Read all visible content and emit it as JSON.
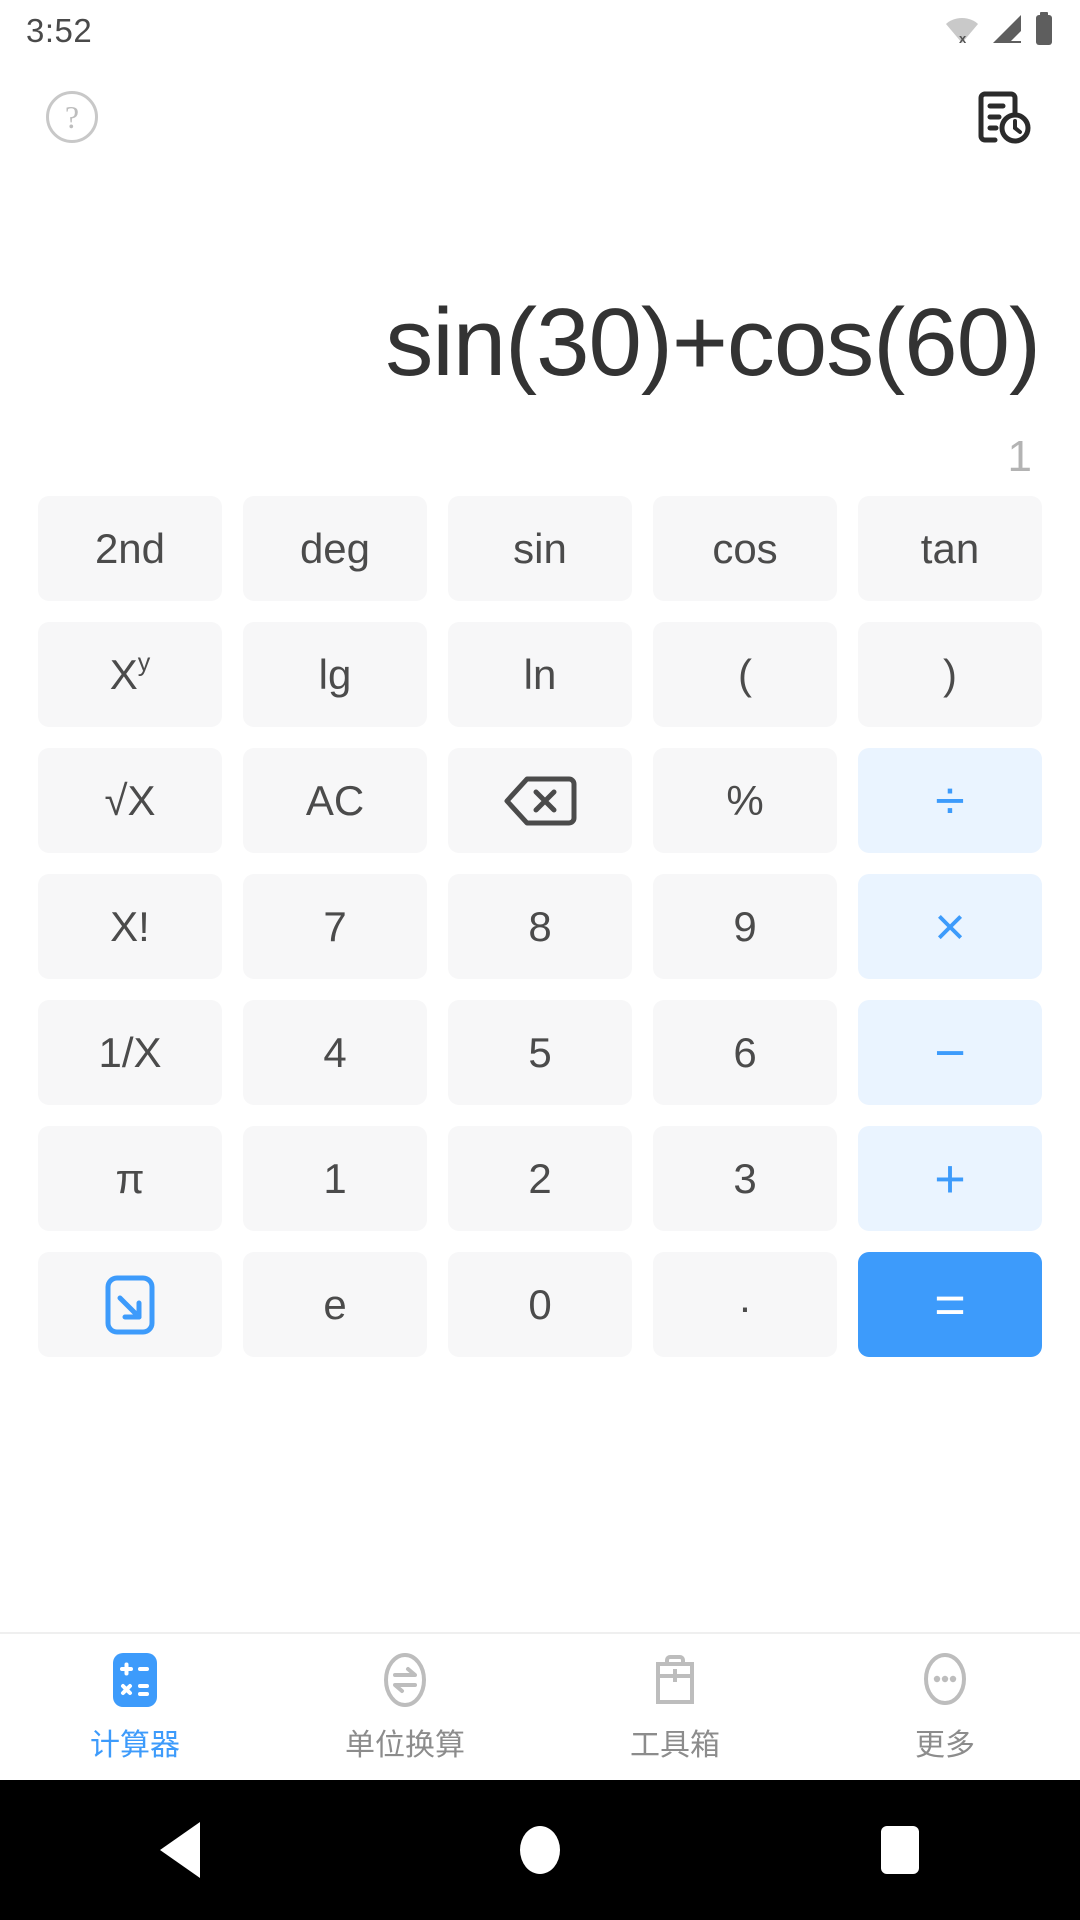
{
  "status_bar": {
    "time": "3:52",
    "icons": [
      "wifi-off-icon",
      "cellular-signal-icon",
      "battery-full-icon"
    ]
  },
  "top_bar": {
    "help_label": "?",
    "help_icon": "help-circle-icon",
    "history_icon": "history-document-icon"
  },
  "display": {
    "expression": "sin(30)+cos(60)",
    "result": "1"
  },
  "colors": {
    "accent": "#3d9bfb",
    "operator_bg": "#eaf4ff",
    "key_bg": "#f7f7f8",
    "expression_text": "#333333",
    "result_text": "#b3b3b3"
  },
  "keypad": {
    "rows": [
      [
        {
          "label": "2nd",
          "name": "key-2nd",
          "type": "fn"
        },
        {
          "label": "deg",
          "name": "key-deg",
          "type": "fn"
        },
        {
          "label": "sin",
          "name": "key-sin",
          "type": "fn"
        },
        {
          "label": "cos",
          "name": "key-cos",
          "type": "fn"
        },
        {
          "label": "tan",
          "name": "key-tan",
          "type": "fn"
        }
      ],
      [
        {
          "label": "X",
          "sup": "y",
          "name": "key-power",
          "type": "fn"
        },
        {
          "label": "lg",
          "name": "key-lg",
          "type": "fn"
        },
        {
          "label": "ln",
          "name": "key-ln",
          "type": "fn"
        },
        {
          "label": "(",
          "name": "key-open-paren",
          "type": "fn"
        },
        {
          "label": ")",
          "name": "key-close-paren",
          "type": "fn"
        }
      ],
      [
        {
          "label": "√X",
          "name": "key-square-root",
          "type": "fn"
        },
        {
          "label": "AC",
          "name": "key-all-clear",
          "type": "fn"
        },
        {
          "label": "",
          "icon": "backspace-icon",
          "name": "key-backspace",
          "type": "fn"
        },
        {
          "label": "%",
          "name": "key-percent",
          "type": "fn"
        },
        {
          "label": "÷",
          "name": "key-divide",
          "type": "op"
        }
      ],
      [
        {
          "label": "X!",
          "name": "key-factorial",
          "type": "fn"
        },
        {
          "label": "7",
          "name": "key-7",
          "type": "num"
        },
        {
          "label": "8",
          "name": "key-8",
          "type": "num"
        },
        {
          "label": "9",
          "name": "key-9",
          "type": "num"
        },
        {
          "label": "×",
          "name": "key-multiply",
          "type": "op"
        }
      ],
      [
        {
          "label": "1/X",
          "name": "key-reciprocal",
          "type": "fn"
        },
        {
          "label": "4",
          "name": "key-4",
          "type": "num"
        },
        {
          "label": "5",
          "name": "key-5",
          "type": "num"
        },
        {
          "label": "6",
          "name": "key-6",
          "type": "num"
        },
        {
          "label": "−",
          "name": "key-subtract",
          "type": "op"
        }
      ],
      [
        {
          "label": "π",
          "name": "key-pi",
          "type": "fn"
        },
        {
          "label": "1",
          "name": "key-1",
          "type": "num"
        },
        {
          "label": "2",
          "name": "key-2",
          "type": "num"
        },
        {
          "label": "3",
          "name": "key-3",
          "type": "num"
        },
        {
          "label": "+",
          "name": "key-add",
          "type": "op"
        }
      ],
      [
        {
          "label": "",
          "icon": "collapse-keypad-icon",
          "name": "key-collapse-keypad",
          "type": "fn"
        },
        {
          "label": "e",
          "name": "key-e",
          "type": "num"
        },
        {
          "label": "0",
          "name": "key-0",
          "type": "num"
        },
        {
          "label": ".",
          "name": "key-decimal-point",
          "type": "num"
        },
        {
          "label": "=",
          "name": "key-equals",
          "type": "equals"
        }
      ]
    ]
  },
  "tab_bar": {
    "items": [
      {
        "label": "计算器",
        "icon": "calculator-icon",
        "name": "tab-calculator",
        "active": true
      },
      {
        "label": "单位换算",
        "icon": "unit-convert-icon",
        "name": "tab-unit-conversion",
        "active": false
      },
      {
        "label": "工具箱",
        "icon": "toolbox-icon",
        "name": "tab-toolbox",
        "active": false
      },
      {
        "label": "更多",
        "icon": "more-dots-icon",
        "name": "tab-more",
        "active": false
      }
    ]
  },
  "android_nav": {
    "back": "back-triangle-icon",
    "home": "home-circle-icon",
    "recents": "recents-square-icon"
  }
}
